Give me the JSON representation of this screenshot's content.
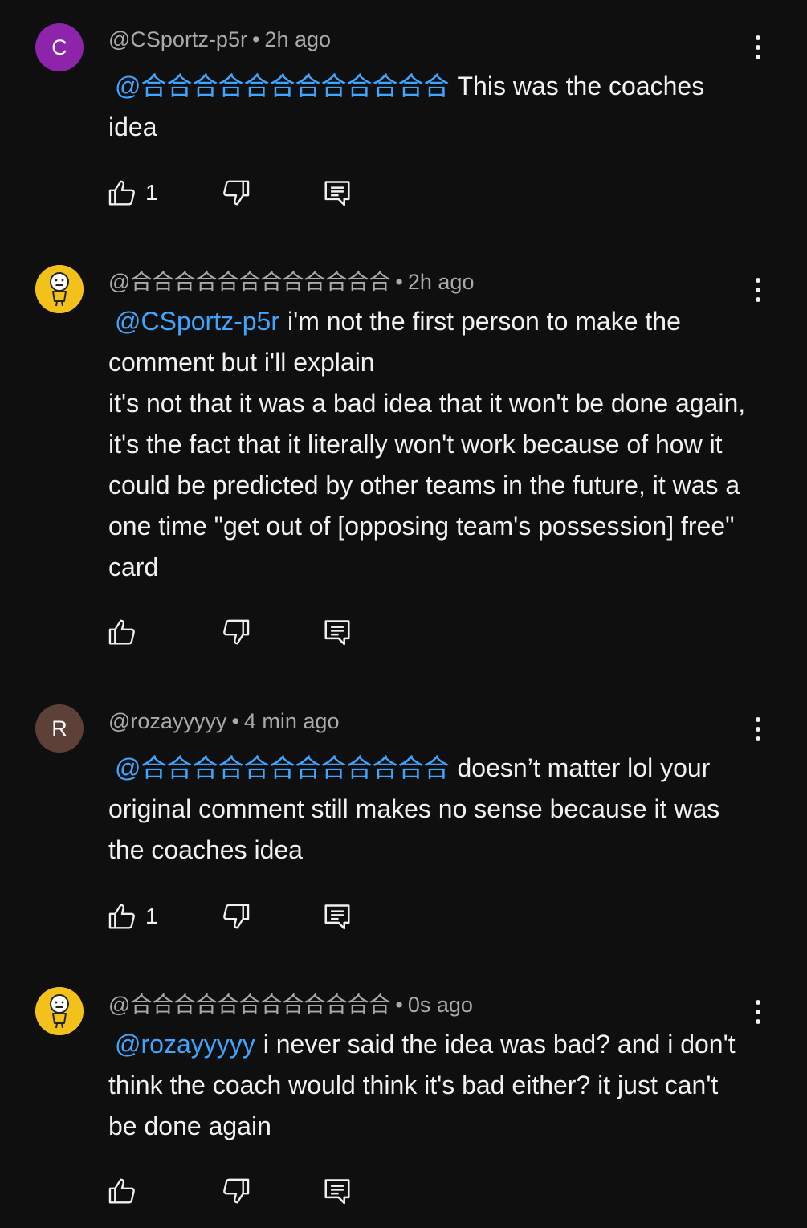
{
  "comments": [
    {
      "avatar_letter": "C",
      "avatar_color": "#8e24aa",
      "handle": "@CSportz-p5r",
      "time": "2h ago",
      "mention": "@合合合合合合合合合合合合",
      "text": "This was the coaches idea",
      "likes": "1"
    },
    {
      "avatar_icon": "smiley-figure-avatar",
      "avatar_color": "#f2c21a",
      "handle": "@合合合合合合合合合合合合",
      "time": "2h ago",
      "mention": "@CSportz-p5r",
      "text": "i'm not the first person to make the comment but i'll explain\nit's not that it was a bad idea that it won't be done again, it's the fact that it literally won't work because of how it could be predicted by other teams in the future, it was a one time \"get out of [opposing team's possession] free\" card",
      "likes": ""
    },
    {
      "avatar_letter": "R",
      "avatar_color": "#5d4037",
      "handle": "@rozayyyyy",
      "time": "4 min ago",
      "mention": "@合合合合合合合合合合合合",
      "text": "doesn’t matter lol your original comment still makes no sense because it was the coaches idea",
      "likes": "1"
    },
    {
      "avatar_icon": "smiley-figure-avatar",
      "avatar_color": "#f2c21a",
      "handle": "@合合合合合合合合合合合合",
      "time": "0s ago",
      "mention": "@rozayyyyy",
      "text": "i never said the idea was bad? and i don't think the coach would think it's bad either? it just can't be done again",
      "likes": ""
    }
  ],
  "separator": "•",
  "icons": {
    "like": "thumbs-up-icon",
    "dislike": "thumbs-down-icon",
    "reply": "reply-icon",
    "more": "more-vert-icon"
  }
}
